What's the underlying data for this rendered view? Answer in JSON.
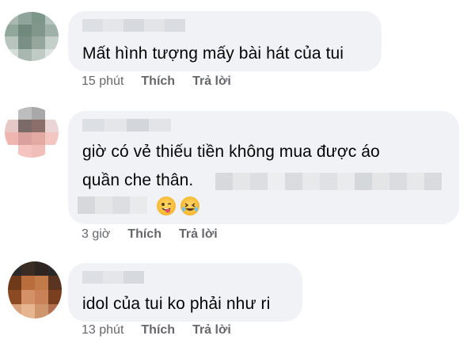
{
  "comments": [
    {
      "text": "Mất hình tượng mấy bài hát của tui",
      "time": "15 phút",
      "like": "Thích",
      "reply": "Trả lời"
    },
    {
      "text_line1": "giờ có vẻ thiếu tiền không mua được áo",
      "text_line2": "quần che thân.",
      "time": "3 giờ",
      "like": "Thích",
      "reply": "Trả lời"
    },
    {
      "text": "idol của tui ko phải như ri",
      "time": "13 phút",
      "like": "Thích",
      "reply": "Trả lời"
    }
  ],
  "emojis": [
    "winking-tongue-emoji",
    "rolling-laughing-emoji"
  ]
}
